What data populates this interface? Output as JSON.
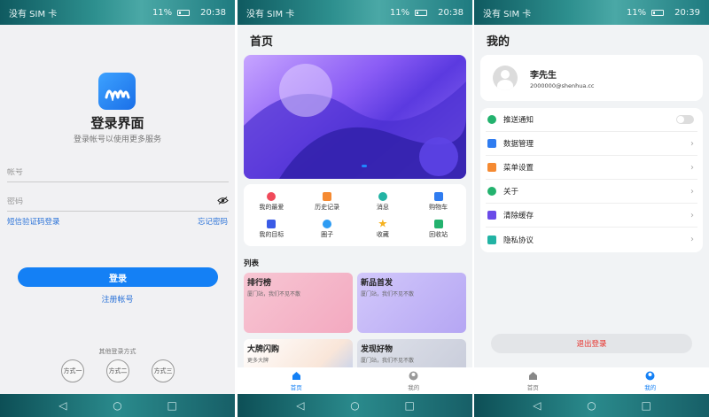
{
  "status_bar": [
    {
      "carrier": "没有 SIM 卡",
      "battery": "11%",
      "time": "20:38"
    },
    {
      "carrier": "没有 SIM 卡",
      "battery": "11%",
      "time": "20:38"
    },
    {
      "carrier": "没有 SIM 卡",
      "battery": "11%",
      "time": "20:39"
    }
  ],
  "login": {
    "title": "登录界面",
    "subtitle": "登录帐号以使用更多服务",
    "account_placeholder": "帐号",
    "password_placeholder": "密码",
    "sms_login": "短信验证码登录",
    "forgot_password": "忘记密码",
    "login_button": "登录",
    "register": "注册帐号",
    "other_methods_title": "其他登录方式",
    "methods": [
      "方式一",
      "方式二",
      "方式三"
    ]
  },
  "home": {
    "title": "首页",
    "grid": [
      {
        "label": "我的最爱",
        "icon": "heart-icon",
        "color": "#f04a5a"
      },
      {
        "label": "历史记录",
        "icon": "history-icon",
        "color": "#f58a32"
      },
      {
        "label": "消息",
        "icon": "message-icon",
        "color": "#22b3a4"
      },
      {
        "label": "购物车",
        "icon": "cart-icon",
        "color": "#2f7cf0"
      },
      {
        "label": "我的目标",
        "icon": "target-icon",
        "color": "#3a5be6"
      },
      {
        "label": "圈子",
        "icon": "group-icon",
        "color": "#2e9cf3"
      },
      {
        "label": "收藏",
        "icon": "star-icon",
        "color": "#f5b11f"
      },
      {
        "label": "回收站",
        "icon": "recycle-icon",
        "color": "#23b26e"
      }
    ],
    "list_title": "列表",
    "cards": [
      {
        "title": "排行榜",
        "subtitle": "厦门站，我们不见不散"
      },
      {
        "title": "新品首发",
        "subtitle": "厦门站，我们不见不散"
      },
      {
        "title": "大牌闪购",
        "subtitle": "更多大牌"
      },
      {
        "title": "发现好物",
        "subtitle": "厦门站，我们不见不散"
      }
    ],
    "tabs": [
      "首页",
      "我的"
    ]
  },
  "mine": {
    "title": "我的",
    "name": "李先生",
    "email": "2000000@shenhua.cc",
    "menu": [
      {
        "label": "推送通知",
        "icon": "chat-icon",
        "color": "#23b26e",
        "toggle": true
      },
      {
        "label": "数据管理",
        "icon": "database-icon",
        "color": "#2f7cf0"
      },
      {
        "label": "菜单设置",
        "icon": "menu-grid-icon",
        "color": "#f58a32"
      },
      {
        "label": "关于",
        "icon": "info-icon",
        "color": "#23b26e"
      },
      {
        "label": "清除缓存",
        "icon": "clean-icon",
        "color": "#6a4be8"
      },
      {
        "label": "隐私协议",
        "icon": "shield-icon",
        "color": "#22b3a4"
      }
    ],
    "logout": "退出登录",
    "tabs": [
      "首页",
      "我的"
    ]
  },
  "nav_glyphs": {
    "back": "◁",
    "home": "○",
    "recent": "□"
  }
}
